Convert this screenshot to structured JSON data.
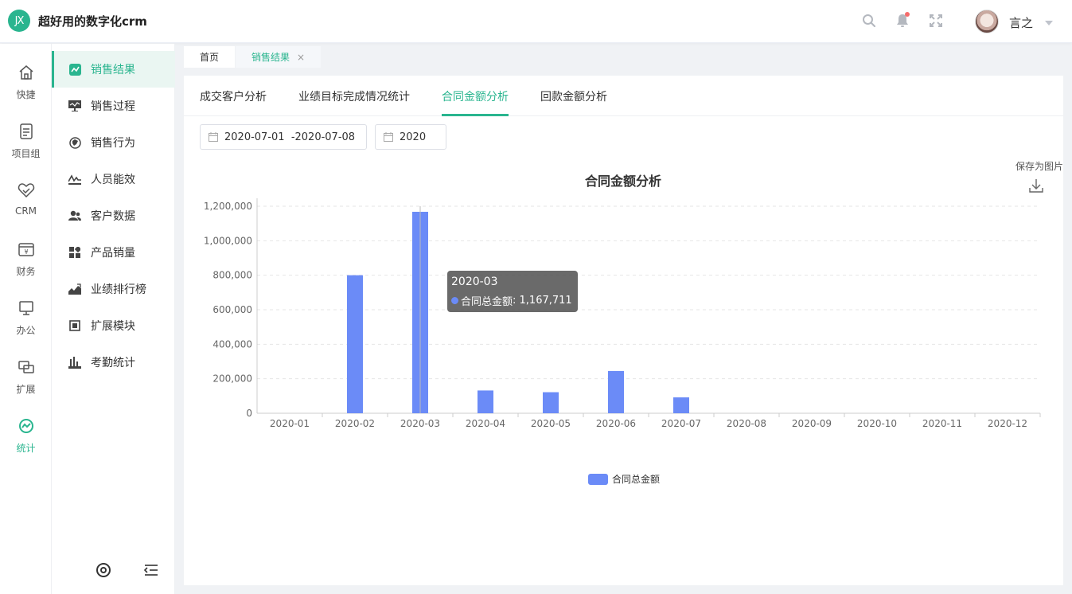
{
  "app": {
    "logo_text": "JX",
    "title": "超好用的数字化crm"
  },
  "header": {
    "username": "言之",
    "icons": [
      "search-icon",
      "bell-icon",
      "fullscreen-icon"
    ]
  },
  "rail": [
    {
      "label": "快捷",
      "icon": "home-icon"
    },
    {
      "label": "项目组",
      "icon": "document-icon"
    },
    {
      "label": "CRM",
      "icon": "heart-handshake-icon"
    },
    {
      "label": "财务",
      "icon": "yen-box-icon"
    },
    {
      "label": "办公",
      "icon": "monitor-icon"
    },
    {
      "label": "扩展",
      "icon": "expand-icon"
    },
    {
      "label": "统计",
      "icon": "stats-icon"
    }
  ],
  "submenu": [
    {
      "label": "销售结果",
      "icon": "sales-result-icon"
    },
    {
      "label": "销售过程",
      "icon": "sales-process-icon"
    },
    {
      "label": "销售行为",
      "icon": "sales-behavior-icon"
    },
    {
      "label": "人员能效",
      "icon": "efficiency-icon"
    },
    {
      "label": "客户数据",
      "icon": "customer-icon"
    },
    {
      "label": "产品销量",
      "icon": "product-icon"
    },
    {
      "label": "业绩排行榜",
      "icon": "ranking-icon"
    },
    {
      "label": "扩展模块",
      "icon": "module-icon"
    },
    {
      "label": "考勤统计",
      "icon": "attendance-icon"
    }
  ],
  "page_tabs": [
    {
      "label": "首页"
    },
    {
      "label": "销售结果",
      "close": "×"
    }
  ],
  "content_tabs": [
    "成交客户分析",
    "业绩目标完成情况统计",
    "合同金额分析",
    "回款金额分析"
  ],
  "filters": {
    "date_range": "2020-07-01  -2020-07-08",
    "year": "2020"
  },
  "save_as_image": "保存为图片",
  "tooltip": {
    "title": "2020-03",
    "series_name": "合同总金额",
    "value_text": "1,167,711"
  },
  "chart_data": {
    "type": "bar",
    "title": "合同金额分析",
    "categories": [
      "2020-01",
      "2020-02",
      "2020-03",
      "2020-04",
      "2020-05",
      "2020-06",
      "2020-07",
      "2020-08",
      "2020-09",
      "2020-10",
      "2020-11",
      "2020-12"
    ],
    "series": [
      {
        "name": "合同总金额",
        "values": [
          0,
          800000,
          1167711,
          132000,
          122000,
          245000,
          92000,
          0,
          0,
          0,
          0,
          0
        ]
      }
    ],
    "y_ticks": [
      "0",
      "200,000",
      "400,000",
      "600,000",
      "800,000",
      "1,000,000",
      "1,200,000"
    ],
    "ylim": [
      0,
      1200000
    ],
    "grid": true,
    "legend": "bottom-center",
    "bar_color": "#6b8bf7"
  }
}
